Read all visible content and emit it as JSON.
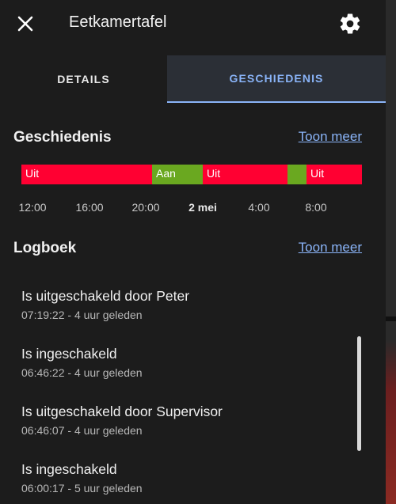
{
  "header": {
    "title": "Eetkamertafel",
    "close_icon": "close-icon",
    "settings_icon": "gear-icon"
  },
  "tabs": [
    {
      "label": "DETAILS",
      "active": false
    },
    {
      "label": "GESCHIEDENIS",
      "active": true
    }
  ],
  "history": {
    "title": "Geschiedenis",
    "more_link": "Toon meer",
    "segments": [
      {
        "label": "Uit",
        "state": "off"
      },
      {
        "label": "Aan",
        "state": "on"
      },
      {
        "label": "Uit",
        "state": "off"
      },
      {
        "label": "",
        "state": "on"
      },
      {
        "label": "Uit",
        "state": "off"
      }
    ],
    "ticks": [
      "12:00",
      "16:00",
      "20:00",
      "2 mei",
      "4:00",
      "8:00"
    ]
  },
  "logbook": {
    "title": "Logboek",
    "more_link": "Toon meer",
    "entries": [
      {
        "title": "Is uitgeschakeld door Peter",
        "subtitle": "07:19:22 - 4 uur geleden"
      },
      {
        "title": "Is ingeschakeld",
        "subtitle": "06:46:22 - 4 uur geleden"
      },
      {
        "title": "Is uitgeschakeld door Supervisor",
        "subtitle": "06:46:07 - 4 uur geleden"
      },
      {
        "title": "Is ingeschakeld",
        "subtitle": "06:00:17 - 5 uur geleden"
      }
    ]
  },
  "colors": {
    "off": "#ff0032",
    "on": "#6aa820",
    "accent": "#8ab4f8"
  }
}
